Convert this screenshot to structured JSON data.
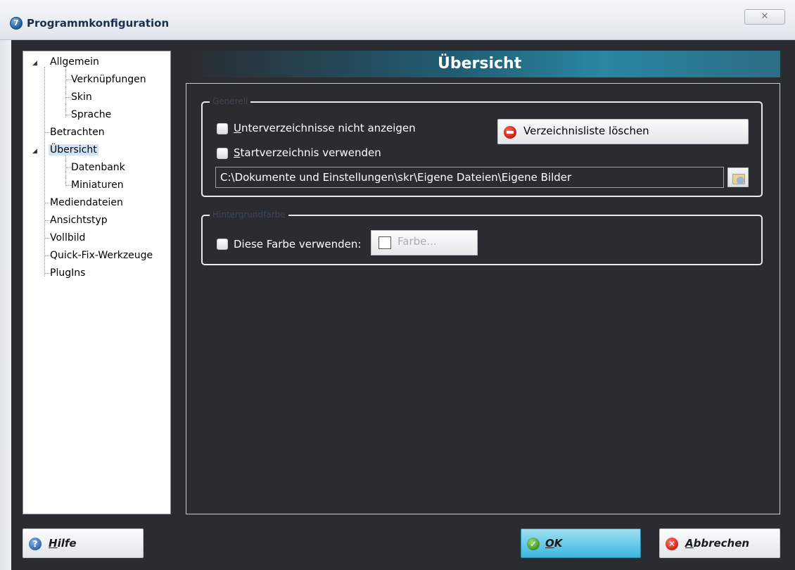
{
  "window": {
    "title": "Programmkonfiguration",
    "app_icon_glyph": "7",
    "close_glyph": "✕"
  },
  "tree": {
    "items": [
      {
        "label": "Allgemein",
        "level": 0,
        "expanded": true
      },
      {
        "label": "Verknüpfungen",
        "level": 1
      },
      {
        "label": "Skin",
        "level": 1
      },
      {
        "label": "Sprache",
        "level": 1
      },
      {
        "label": "Betrachten",
        "level": 0
      },
      {
        "label": "Übersicht",
        "level": 0,
        "expanded": true,
        "selected": true
      },
      {
        "label": "Datenbank",
        "level": 1
      },
      {
        "label": "Miniaturen",
        "level": 1
      },
      {
        "label": "Mediendateien",
        "level": 0
      },
      {
        "label": "Ansichtstyp",
        "level": 0
      },
      {
        "label": "Vollbild",
        "level": 0
      },
      {
        "label": "Quick-Fix-Werkzeuge",
        "level": 0
      },
      {
        "label": "PlugIns",
        "level": 0
      }
    ]
  },
  "header": {
    "title": "Übersicht"
  },
  "group_general": {
    "legend": "Generell",
    "hide_subdirs": {
      "accel": "U",
      "rest": "nterverzeichnisse nicht anzeigen",
      "checked": false
    },
    "use_start_dir": {
      "accel": "S",
      "rest": "tartverzeichnis verwenden",
      "checked": false
    },
    "clear_list_button": "Verzeichnisliste löschen",
    "path_value": "C:\\Dokumente und Einstellungen\\skr\\Eigene Dateien\\Eigene Bilder"
  },
  "group_background": {
    "legend": "Hintergrundfarbe",
    "use_color": {
      "label": "Diese Farbe verwenden:",
      "checked": false
    },
    "color_button": "Farbe..."
  },
  "buttons": {
    "help": {
      "accel": "H",
      "rest": "ilfe"
    },
    "ok": {
      "accel": "O",
      "rest": "K"
    },
    "cancel": {
      "accel": "A",
      "rest": "bbrechen"
    }
  },
  "colors": {
    "background": "#2a2c31",
    "header_accent": "#2a86a3",
    "ok_button": "#3ab8dd",
    "selection": "#cfe5f7"
  }
}
